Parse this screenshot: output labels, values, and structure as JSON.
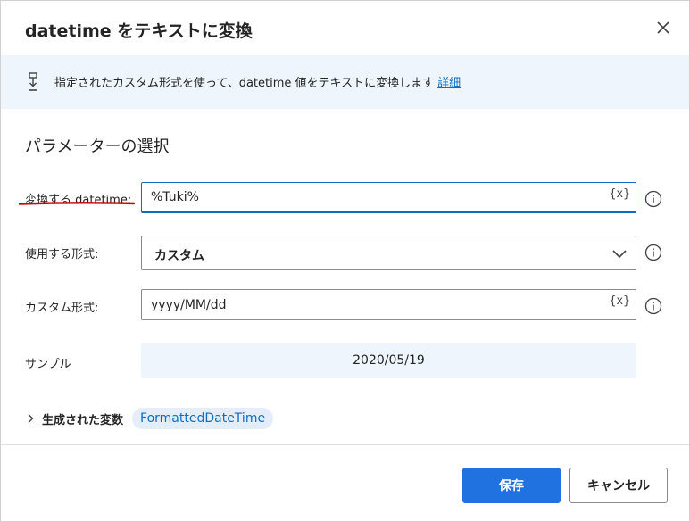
{
  "dialog": {
    "title": "datetime をテキストに変換",
    "close_icon": "close-icon"
  },
  "banner": {
    "icon": "convert-icon",
    "text": "指定されたカスタム形式を使って、datetime 値をテキストに変換します",
    "link": "詳細"
  },
  "section": {
    "title": "パラメーターの選択"
  },
  "params": {
    "datetime_label": "変換する datetime:",
    "datetime_value": "%Tuki%",
    "format_label": "使用する形式:",
    "format_value": "カスタム",
    "custom_label": "カスタム形式:",
    "custom_value": "yyyy/MM/dd",
    "var_button": "{x}",
    "sample_label": "サンプル",
    "sample_value": "2020/05/19"
  },
  "generated": {
    "label": "生成された変数",
    "variable": "FormattedDateTime"
  },
  "footer": {
    "save": "保存",
    "cancel": "キャンセル"
  },
  "colors": {
    "primary": "#1f72e0",
    "banner_bg": "#eff5fc",
    "link": "#0f6cbd",
    "annotation_red": "#cc0000"
  }
}
